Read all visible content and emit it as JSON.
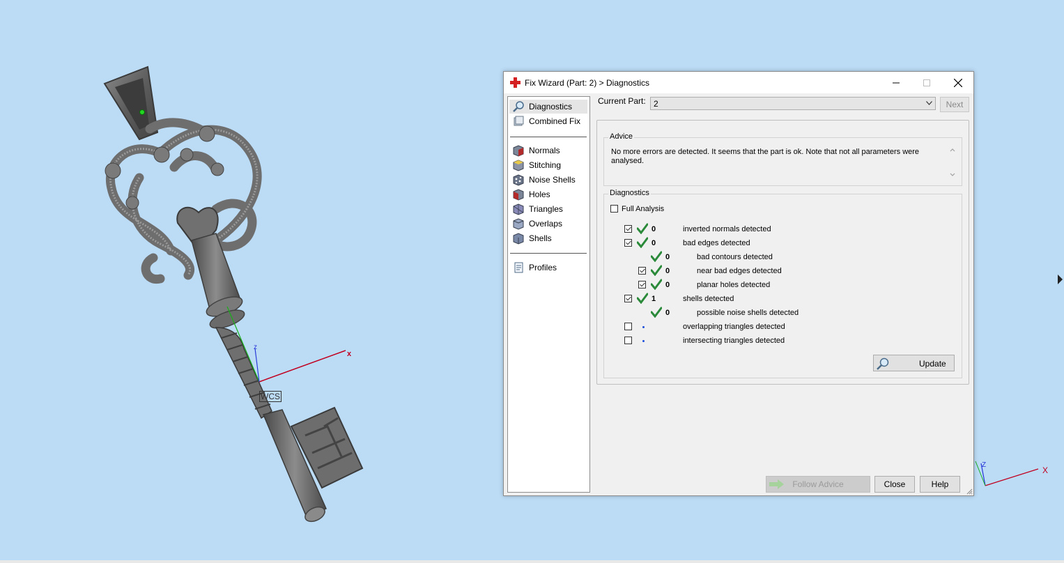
{
  "viewport": {
    "coord_label": "WCS",
    "axes": {
      "x": "x",
      "z": "z"
    },
    "mini_axes": {
      "x": "X",
      "z": "Z"
    }
  },
  "dialog": {
    "title": "Fix Wizard (Part: 2) > Diagnostics",
    "nav": {
      "items": [
        {
          "label": "Diagnostics",
          "icon": "magnifier-icon",
          "selected": true
        },
        {
          "label": "Combined Fix",
          "icon": "combined-fix-icon"
        },
        {
          "label": "Normals",
          "icon": "normals-icon"
        },
        {
          "label": "Stitching",
          "icon": "stitching-icon"
        },
        {
          "label": "Noise Shells",
          "icon": "noise-shells-icon"
        },
        {
          "label": "Holes",
          "icon": "holes-icon"
        },
        {
          "label": "Triangles",
          "icon": "triangles-icon"
        },
        {
          "label": "Overlaps",
          "icon": "overlaps-icon"
        },
        {
          "label": "Shells",
          "icon": "shells-icon"
        },
        {
          "label": "Profiles",
          "icon": "profiles-icon"
        }
      ]
    },
    "current_part": {
      "label": "Current Part:",
      "value": "2"
    },
    "next_label": "Next",
    "advice": {
      "title": "Advice",
      "text": "No more errors are detected. It seems that the part is ok. Note that not all parameters were analysed."
    },
    "diagnostics": {
      "title": "Diagnostics",
      "full_analysis_label": "Full Analysis",
      "full_analysis_checked": false,
      "rows": [
        {
          "checkbox": true,
          "checked": true,
          "status": "ok",
          "count": "0",
          "label": "inverted normals detected",
          "indent": 0
        },
        {
          "checkbox": true,
          "checked": true,
          "status": "ok",
          "count": "0",
          "label": "bad edges detected",
          "indent": 0
        },
        {
          "checkbox": false,
          "checked": false,
          "status": "ok",
          "count": "0",
          "label": "bad contours detected",
          "indent": 1
        },
        {
          "checkbox": true,
          "checked": true,
          "status": "ok",
          "count": "0",
          "label": "near bad edges detected",
          "indent": 1
        },
        {
          "checkbox": true,
          "checked": true,
          "status": "ok",
          "count": "0",
          "label": "planar holes detected",
          "indent": 1
        },
        {
          "checkbox": true,
          "checked": true,
          "status": "ok",
          "count": "1",
          "label": "shells detected",
          "indent": 0
        },
        {
          "checkbox": false,
          "checked": false,
          "status": "ok",
          "count": "0",
          "label": "possible noise shells detected",
          "indent": 1
        },
        {
          "checkbox": true,
          "checked": false,
          "status": "pending",
          "count": "",
          "label": "overlapping triangles detected",
          "indent": 0
        },
        {
          "checkbox": true,
          "checked": false,
          "status": "pending",
          "count": "",
          "label": "intersecting triangles detected",
          "indent": 0
        }
      ]
    },
    "update_label": "Update",
    "buttons": {
      "follow_advice": "Follow Advice",
      "close": "Close",
      "help": "Help"
    },
    "colors": {
      "check_green": "#2a8a3a",
      "dot_blue": "#1d4fd8",
      "title_icon_red": "#d42020"
    }
  }
}
